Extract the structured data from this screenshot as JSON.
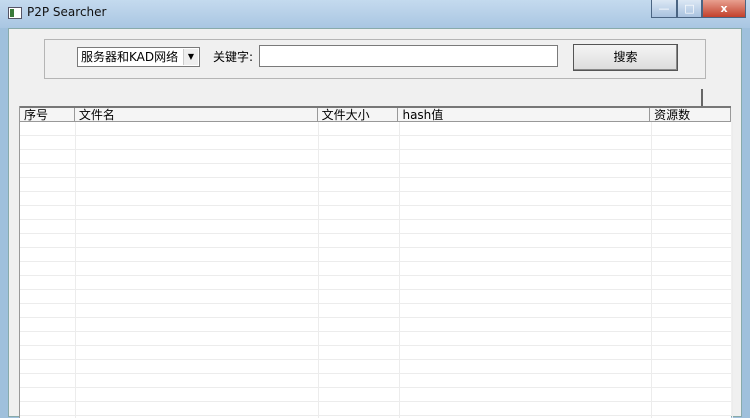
{
  "window": {
    "title": "P2P Searcher",
    "minimize": "—",
    "maximize": "□",
    "close": "x"
  },
  "search": {
    "network_select": "服务器和KAD网络",
    "keyword_label": "关键字:",
    "keyword_value": "",
    "search_button": "搜索"
  },
  "table": {
    "columns": [
      "序号",
      "文件名",
      "文件大小",
      "hash值",
      "资源数"
    ]
  }
}
